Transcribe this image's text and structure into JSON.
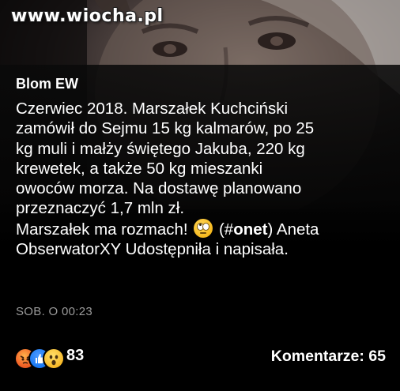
{
  "watermark": {
    "text": "www.wiocha.pl"
  },
  "post": {
    "author": "Blom EW",
    "lines": [
      "Czerwiec 2018. Marszałek Kuchciński",
      "zamówił do Sejmu 15 kg kalmarów, po 25",
      "kg muli i małży świętego Jakuba, 220 kg",
      "krewetek, a także 50 kg mieszanki",
      "owoców morza. Na dostawę planowano",
      "przeznaczyć 1,7 mln zł."
    ],
    "line7_before_emoji": "Marszałek ma rozmach! ",
    "line7_emoji": "face-with-rolling-eyes",
    "line7_open": " (#",
    "line7_bold": "onet",
    "line7_after": ") Aneta",
    "line8": "ObserwatorXY Udostępniła i napisała.",
    "timestamp": "SOB. O 00:23"
  },
  "footer": {
    "reactions": [
      "angry-icon",
      "like-icon",
      "wow-icon"
    ],
    "reaction_count": "83",
    "comments_label": "Komentarze: 65"
  },
  "colors": {
    "background": "#000000",
    "text": "#ffffff",
    "timestamp": "#9a9a9a",
    "like_blue": "#1877f2",
    "angry_orange": "#f56a2a",
    "wow_yellow": "#f7b928"
  }
}
